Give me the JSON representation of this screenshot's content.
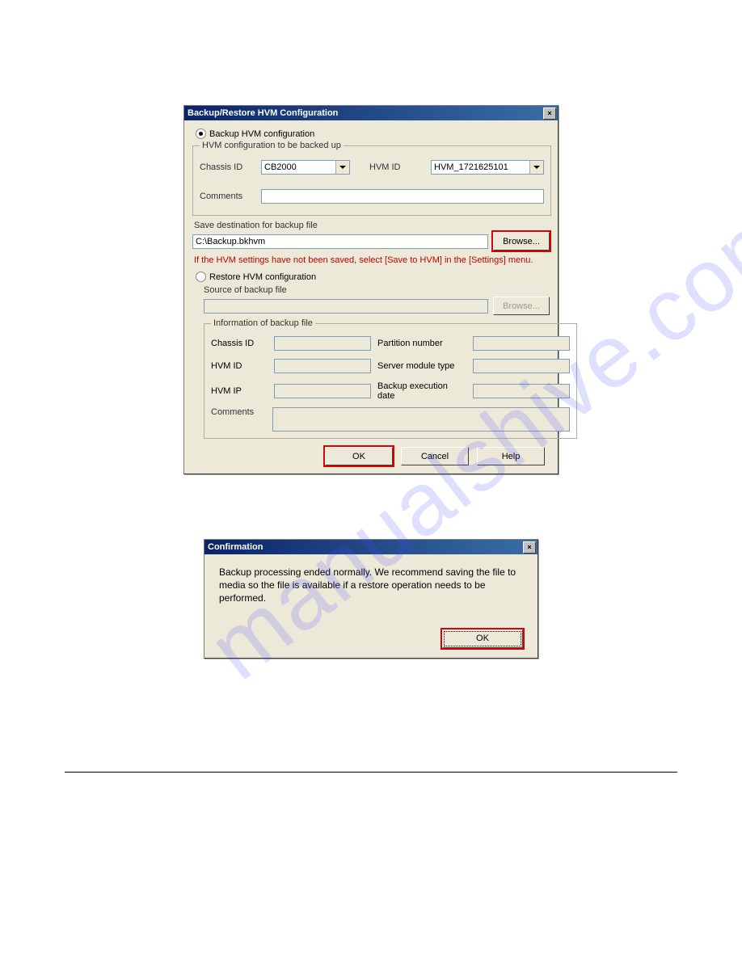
{
  "dialog1": {
    "title": "Backup/Restore HVM Configuration",
    "backup_radio_label": "Backup HVM configuration",
    "group_backup_legend": "HVM configuration to be backed up",
    "chassis_id_label": "Chassis ID",
    "chassis_id_value": "CB2000",
    "hvm_id_label": "HVM ID",
    "hvm_id_value": "HVM_1721625101",
    "comments_label": "Comments",
    "save_dest_label": "Save destination for backup file",
    "save_dest_value": "C:\\Backup.bkhvm",
    "browse_label": "Browse...",
    "warning": "If the HVM settings have not been saved, select [Save to HVM] in the [Settings] menu.",
    "restore_radio_label": "Restore HVM configuration",
    "source_label": "Source of backup file",
    "browse2_label": "Browse...",
    "info_legend": "Information of backup file",
    "info_chassis_label": "Chassis ID",
    "info_partition_label": "Partition number",
    "info_hvmid_label": "HVM ID",
    "info_server_label": "Server module type",
    "info_hvmip_label": "HVM IP",
    "info_date_label": "Backup execution date",
    "info_comments_label": "Comments",
    "ok_label": "OK",
    "cancel_label": "Cancel",
    "help_label": "Help"
  },
  "dialog2": {
    "title": "Confirmation",
    "message": "Backup processing ended normally. We recommend saving the file to media so the file is available if a restore operation needs to be performed.",
    "ok_label": "OK"
  }
}
